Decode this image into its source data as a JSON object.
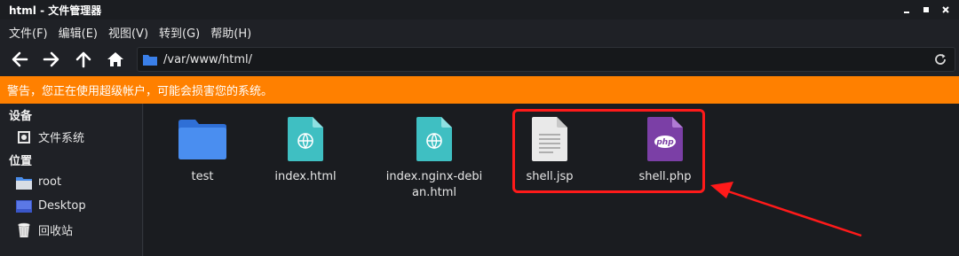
{
  "window": {
    "title": "html - 文件管理器"
  },
  "menu": [
    {
      "label": "文件(F)"
    },
    {
      "label": "编辑(E)"
    },
    {
      "label": "视图(V)"
    },
    {
      "label": "转到(G)"
    },
    {
      "label": "帮助(H)"
    }
  ],
  "toolbar": {
    "location_path": "/var/www/html/",
    "nav_icons": [
      "back-arrow-icon",
      "forward-arrow-icon",
      "up-arrow-icon",
      "home-icon"
    ]
  },
  "warning": {
    "text": "警告，您正在使用超级帐户，可能会损害您的系统。"
  },
  "sidebar": {
    "devices_title": "设备",
    "devices": [
      {
        "label": "文件系统",
        "icon": "drive-icon"
      }
    ],
    "places_title": "位置",
    "places": [
      {
        "label": "root",
        "icon": "folder-icon"
      },
      {
        "label": "Desktop",
        "icon": "desktop-icon"
      },
      {
        "label": "回收站",
        "icon": "trash-icon"
      }
    ]
  },
  "files": [
    {
      "name": "test",
      "type": "folder"
    },
    {
      "name": "index.html",
      "type": "html"
    },
    {
      "name": "index.nginx-debian.html",
      "type": "html"
    },
    {
      "name": "shell.jsp",
      "type": "text"
    },
    {
      "name": "shell.php",
      "type": "php"
    }
  ],
  "colors": {
    "warning_bg": "#ff8000",
    "folder_blue": "#3a7fe8",
    "html_teal": "#3fbfc2",
    "php_purple": "#7b3fa6",
    "annotation_red": "#ff1a1a"
  }
}
